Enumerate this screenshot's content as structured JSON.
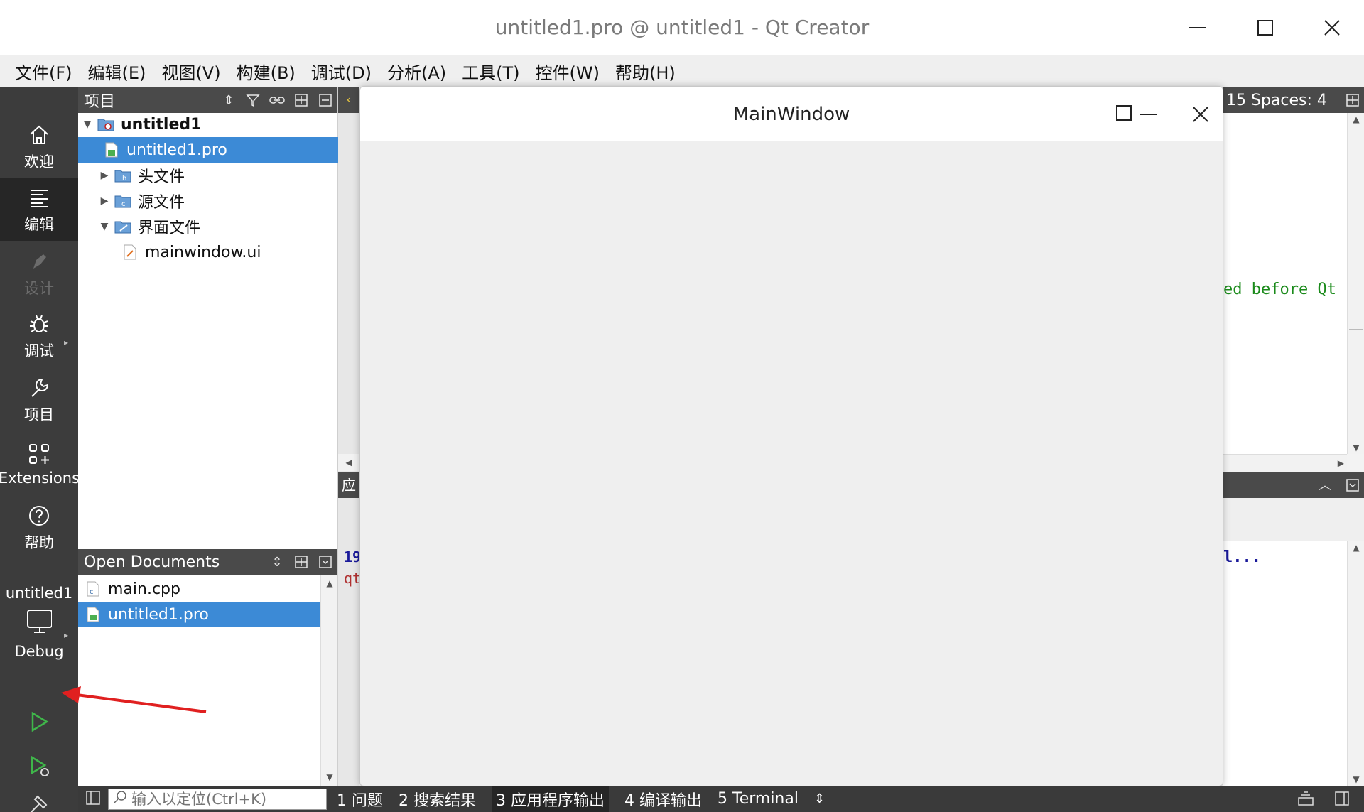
{
  "window": {
    "title": "untitled1.pro @ untitled1 - Qt Creator",
    "minimize_glyph": "—",
    "maximize_glyph": "☐",
    "close_glyph": "✕"
  },
  "menubar": {
    "items": [
      {
        "label": "文件(F)"
      },
      {
        "label": "编辑(E)"
      },
      {
        "label": "视图(V)"
      },
      {
        "label": "构建(B)"
      },
      {
        "label": "调试(D)"
      },
      {
        "label": "分析(A)"
      },
      {
        "label": "工具(T)"
      },
      {
        "label": "控件(W)"
      },
      {
        "label": "帮助(H)"
      }
    ]
  },
  "modebar": {
    "modes": [
      {
        "label": "欢迎",
        "icon": "home-icon"
      },
      {
        "label": "编辑",
        "icon": "edit-lines-icon"
      },
      {
        "label": "设计",
        "icon": "pen-icon"
      },
      {
        "label": "调试",
        "icon": "bug-icon"
      },
      {
        "label": "项目",
        "icon": "wrench-icon"
      },
      {
        "label": "Extensions",
        "icon": "grid-plus-icon"
      },
      {
        "label": "帮助",
        "icon": "help-icon"
      }
    ],
    "target_project": "untitled1",
    "target_config": "Debug"
  },
  "project_panel": {
    "title": "项目",
    "tree": [
      {
        "label": "untitled1",
        "icon": "project-folder-icon"
      },
      {
        "label": "untitled1.pro",
        "icon": "pro-file-icon"
      },
      {
        "label": "头文件",
        "icon": "header-folder-icon"
      },
      {
        "label": "源文件",
        "icon": "source-folder-icon"
      },
      {
        "label": "界面文件",
        "icon": "forms-folder-icon"
      },
      {
        "label": "mainwindow.ui",
        "icon": "ui-file-icon"
      }
    ]
  },
  "open_documents": {
    "title": "Open Documents",
    "items": [
      {
        "label": "main.cpp"
      },
      {
        "label": "untitled1.pro"
      }
    ]
  },
  "editor": {
    "right_toolbar_text": "15  Spaces: 4",
    "code_fragment": "ed before Qt (",
    "output_tab_partial": "应",
    "output_line_1": "19",
    "output_line_2": "qt",
    "output_right_fragment": "l..."
  },
  "mainwindow": {
    "title": "MainWindow"
  },
  "statusbar": {
    "locator_placeholder": "输入以定位(Ctrl+K)",
    "panes": [
      {
        "label": "1 问题"
      },
      {
        "label": "2 搜索结果"
      },
      {
        "label": "3 应用程序输出"
      },
      {
        "label": "4 编译输出"
      },
      {
        "label": "5 Terminal"
      }
    ]
  },
  "colors": {
    "selection": "#3c8ad6",
    "modebar_bg": "#3c3c3c",
    "annotation_arrow": "#e02020"
  }
}
